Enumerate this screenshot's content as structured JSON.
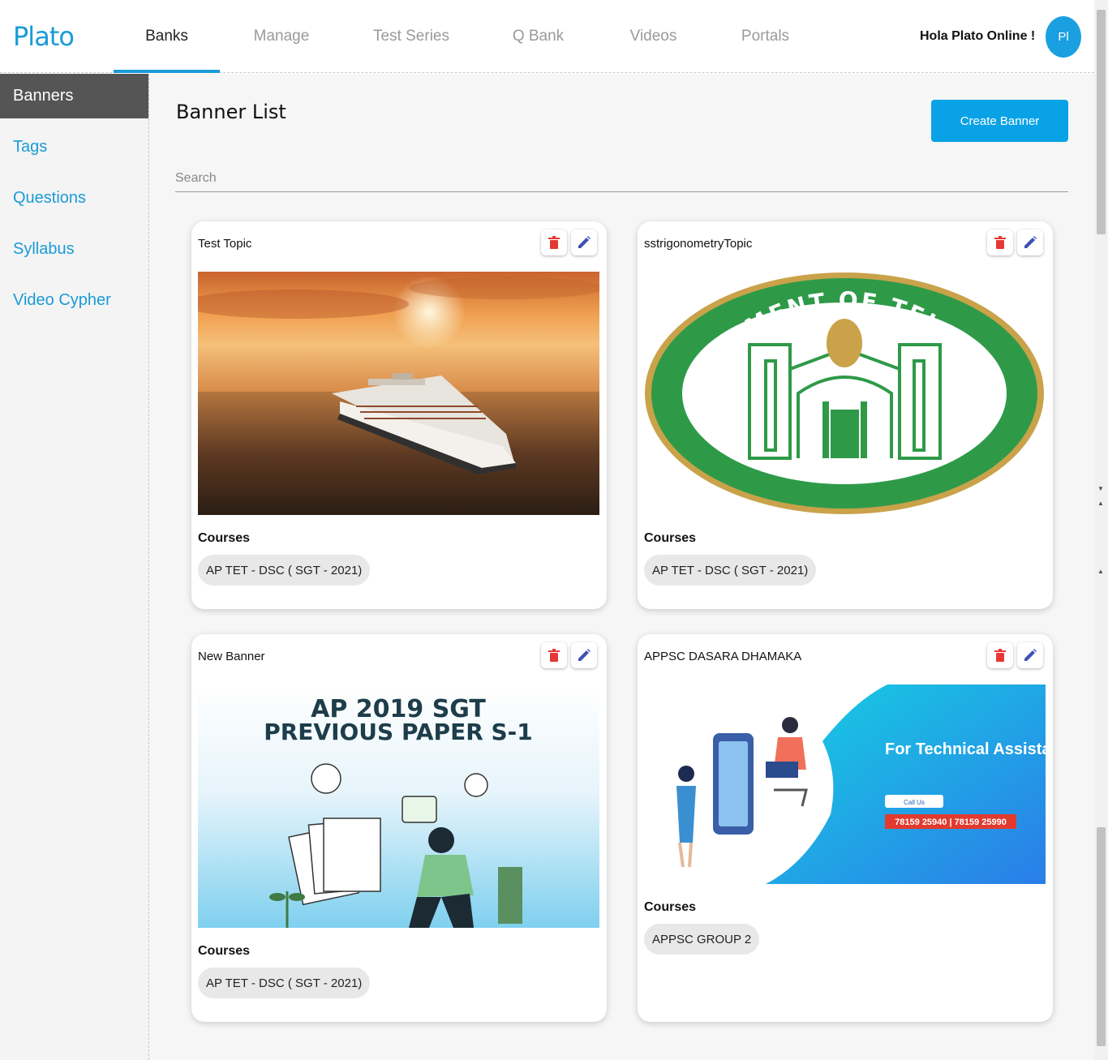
{
  "app": {
    "logo": "Plato",
    "greeting": "Hola Plato Online !",
    "avatar_initials": "Pl",
    "accent_color": "#1a9bd7"
  },
  "nav": {
    "tabs": [
      {
        "label": "Banks",
        "active": true
      },
      {
        "label": "Manage",
        "active": false
      },
      {
        "label": "Test Series",
        "active": false
      },
      {
        "label": "Q Bank",
        "active": false
      },
      {
        "label": "Videos",
        "active": false
      },
      {
        "label": "Portals",
        "active": false
      }
    ]
  },
  "sidebar": {
    "items": [
      {
        "label": "Banners",
        "active": true
      },
      {
        "label": "Tags",
        "active": false
      },
      {
        "label": "Questions",
        "active": false
      },
      {
        "label": "Syllabus",
        "active": false
      },
      {
        "label": "Video Cypher",
        "active": false
      }
    ]
  },
  "main": {
    "title": "Banner List",
    "create_button": "Create Banner",
    "search_placeholder": "Search",
    "courses_label": "Courses",
    "cards": [
      {
        "title": "Test Topic",
        "image": "cruise-ship-sunset",
        "courses": [
          "AP TET - DSC ( SGT - 2021)"
        ]
      },
      {
        "title": "sstrigonometryTopic",
        "image": "government-of-telangana-seal",
        "courses": [
          "AP TET - DSC ( SGT - 2021)"
        ]
      },
      {
        "title": "New Banner",
        "image": "ap-2019-sgt-previous-paper",
        "image_text": [
          "AP 2019 SGT",
          "PREVIOUS PAPER S-1"
        ],
        "courses": [
          "AP TET - DSC ( SGT - 2021)"
        ]
      },
      {
        "title": "APPSC DASARA DHAMAKA",
        "image": "technical-assistance",
        "image_text": [
          "For Technical Assistance",
          "Call Us",
          "78159 25940 | 78159 25990"
        ],
        "courses": [
          "APPSC GROUP 2"
        ]
      }
    ]
  },
  "seal": {
    "outer_text": "GOVERNMENT OF TELANGANA"
  }
}
